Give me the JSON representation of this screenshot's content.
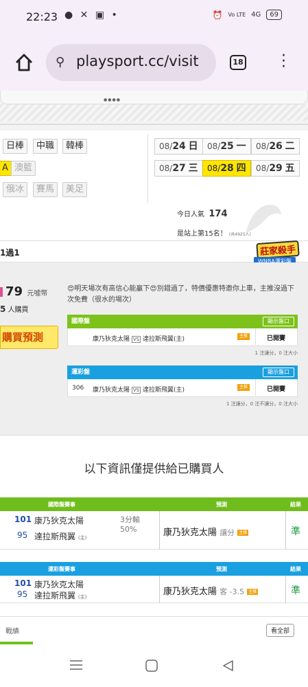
{
  "status": {
    "time": "22:23",
    "left_icons": "● ✕ ▣ •",
    "net": "Vo LTE",
    "signal": "4G",
    "battery": "69"
  },
  "browser": {
    "url": "playsport.cc/visit",
    "tabs_count": "18"
  },
  "categories": [
    {
      "label": "日棒",
      "active": true
    },
    {
      "label": "中職",
      "active": true
    },
    {
      "label": "韓棒",
      "active": true
    },
    {
      "label": "A",
      "active": true
    },
    {
      "label": "澳籃",
      "active": false
    },
    {
      "label": "俄冰",
      "active": false
    },
    {
      "label": "賽馬",
      "active": false
    },
    {
      "label": "美足",
      "active": false
    }
  ],
  "dates": [
    {
      "md": "08/",
      "d": "24",
      "wd": "日"
    },
    {
      "md": "08/",
      "d": "25",
      "wd": "一"
    },
    {
      "md": "08/",
      "d": "26",
      "wd": "二"
    },
    {
      "md": "08/",
      "d": "27",
      "wd": "三"
    },
    {
      "md": "08/",
      "d": "28",
      "wd": "四"
    },
    {
      "md": "08/",
      "d": "29",
      "wd": "五"
    }
  ],
  "popularity": {
    "label": "今日人氣",
    "value": "174",
    "rank": "是站上第15名！",
    "extra": "(共4925人)"
  },
  "seller": {
    "title": "1過1",
    "badge": "莊家殺手",
    "badge_sub": "WNBA運彩盤",
    "price": "79",
    "price_unit": "元噓幣",
    "buyers": "5",
    "buyers_unit": "人購買",
    "buy_label": "購買預測"
  },
  "notice": "😍明天場次有高信心能贏下😍別錯過了，特價優惠特邀你上車，主推沒過下次免費（很水的場次）",
  "groups": [
    {
      "title": "國際盤",
      "show": "顯示盤口",
      "no": "",
      "home": "康乃狄克太陽",
      "vs": "VS",
      "away": "達拉斯飛翼(主)",
      "tag": "主推",
      "state": "已開賽",
      "stat": "1 注讓分，0 注大小",
      "color": "#7cc21b"
    },
    {
      "title": "運彩盤",
      "show": "顯示盤口",
      "no": "306",
      "home": "康乃狄克太陽",
      "vs": "VS",
      "away": "達拉斯飛翼(主)",
      "tag": "主推",
      "state": "已開賽",
      "stat": "1 注讓分，0 注不讓分，0 注大小",
      "color": "#1aa0e0"
    }
  ],
  "info_head": "以下資訊僅提供給已購買人",
  "tables": [
    {
      "h1": "國際盤賽事",
      "h2": "預測",
      "h3": "結果",
      "n1": "101",
      "t1": "康乃狄克太陽",
      "n2": "95",
      "t2": "達拉斯飛翼",
      "home_mark": "(主)",
      "odds1": "3分輸",
      "odds2": "50%",
      "pred": "康乃狄克太陽",
      "pred_note": "讓分",
      "tag": "主推",
      "result": "準",
      "color": "#6fbd1d"
    },
    {
      "h1": "運彩盤賽事",
      "h2": "預測",
      "h3": "結果",
      "n1": "101",
      "t1": "康乃狄克太陽",
      "n2": "95",
      "t2": "達拉斯飛翼",
      "home_mark": "(主)",
      "odds1": "",
      "odds2": "",
      "pred": "康乃狄克太陽",
      "pred_note": "客 -3.5",
      "tag": "主推",
      "result": "準",
      "color": "#1aa0e0"
    }
  ],
  "record": {
    "label": "戰績",
    "all": "看全部"
  },
  "colors": {
    "accent_green": "#7cc21b",
    "accent_blue": "#1aa0e0",
    "active_date": "#ffe600",
    "price_btn": "#ffe86a"
  }
}
